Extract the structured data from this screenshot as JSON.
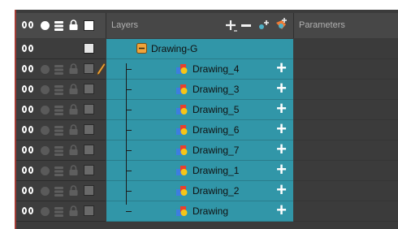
{
  "header": {
    "layers_label": "Layers",
    "params_label": "Parameters",
    "add_label": "+",
    "remove_label": "−",
    "add_suffix": "+"
  },
  "group": {
    "name": "Drawing-G",
    "plus": ""
  },
  "layers": [
    {
      "name": "Drawing_4",
      "plus": "+",
      "pencil": true
    },
    {
      "name": "Drawing_3",
      "plus": "+",
      "pencil": false
    },
    {
      "name": "Drawing_5",
      "plus": "+",
      "pencil": false
    },
    {
      "name": "Drawing_6",
      "plus": "+",
      "pencil": false
    },
    {
      "name": "Drawing_7",
      "plus": "+",
      "pencil": false
    },
    {
      "name": "Drawing_1",
      "plus": "+",
      "pencil": false
    },
    {
      "name": "Drawing_2",
      "plus": "+",
      "pencil": false
    },
    {
      "name": "Drawing",
      "plus": "+",
      "pencil": false
    }
  ],
  "colors": {
    "accent": "#3196a8",
    "panel": "#3b3b3b",
    "group_icon": "#f0a43a"
  }
}
